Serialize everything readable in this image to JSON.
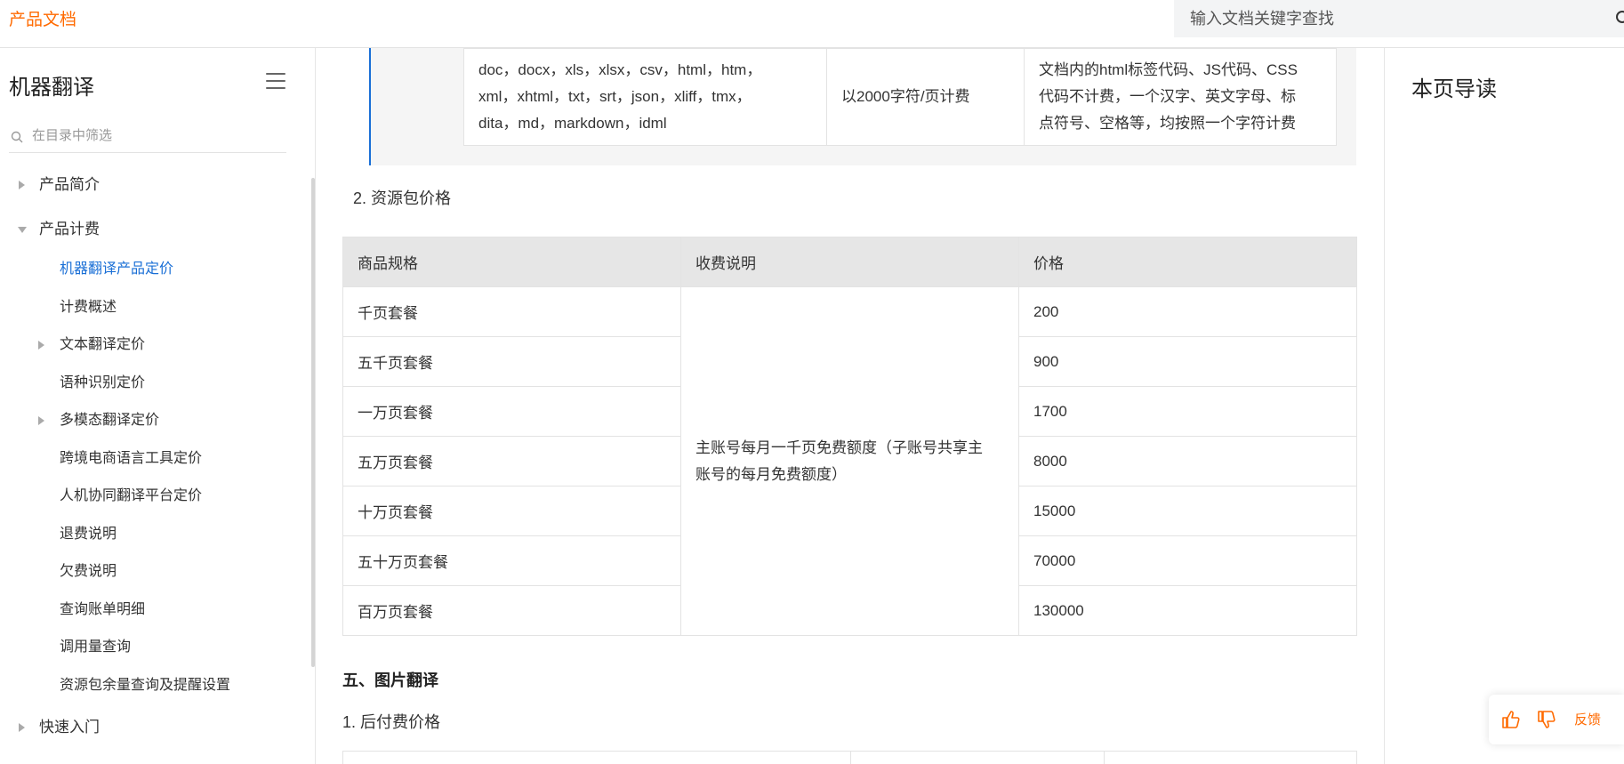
{
  "header": {
    "brand": "产品文档",
    "search_placeholder": "输入文档关键字查找"
  },
  "sidebar": {
    "title": "机器翻译",
    "filter_placeholder": "在目录中筛选",
    "items": [
      {
        "label": "产品简介"
      },
      {
        "label": "产品计费"
      },
      {
        "label": "机器翻译产品定价"
      },
      {
        "label": "计费概述"
      },
      {
        "label": "文本翻译定价"
      },
      {
        "label": "语种识别定价"
      },
      {
        "label": "多模态翻译定价"
      },
      {
        "label": "跨境电商语言工具定价"
      },
      {
        "label": "人机协同翻译平台定价"
      },
      {
        "label": "退费说明"
      },
      {
        "label": "欠费说明"
      },
      {
        "label": "查询账单明细"
      },
      {
        "label": "调用量查询"
      },
      {
        "label": "资源包余量查询及提醒设置"
      },
      {
        "label": "快速入门"
      }
    ]
  },
  "main": {
    "format_table": {
      "formats_line1": "doc，docx，xls，xlsx，csv，html，htm，",
      "formats_line2": "xml，xhtml，txt，srt，json，xliff，tmx，",
      "formats_line3": "dita，md，markdown，idml",
      "billing_unit": "以2000字符/页计费",
      "rule_line1": "文档内的html标签代码、JS代码、CSS",
      "rule_line2": "代码不计费，一个汉字、英文字母、标",
      "rule_line3": "点符号、空格等，均按照一个字符计费"
    },
    "package_section_label": "2. 资源包价格",
    "package_table": {
      "headers": [
        "商品规格",
        "收费说明",
        "价格"
      ],
      "desc_line1": "主账号每月一千页免费额度（子账号共享主",
      "desc_line2": "账号的每月免费额度）",
      "rows": [
        {
          "spec": "千页套餐",
          "price": "200"
        },
        {
          "spec": "五千页套餐",
          "price": "900"
        },
        {
          "spec": "一万页套餐",
          "price": "1700"
        },
        {
          "spec": "五万页套餐",
          "price": "8000"
        },
        {
          "spec": "十万页套餐",
          "price": "15000"
        },
        {
          "spec": "五十万页套餐",
          "price": "70000"
        },
        {
          "spec": "百万页套餐",
          "price": "130000"
        }
      ]
    },
    "image_heading": "五、图片翻译",
    "postpay_label": "1. 后付费价格"
  },
  "right_panel": {
    "toc_title": "本页导读"
  },
  "feedback": {
    "label": "反馈"
  },
  "colors": {
    "brand_orange": "#ff6a00",
    "active_blue": "#1a6fd6"
  }
}
